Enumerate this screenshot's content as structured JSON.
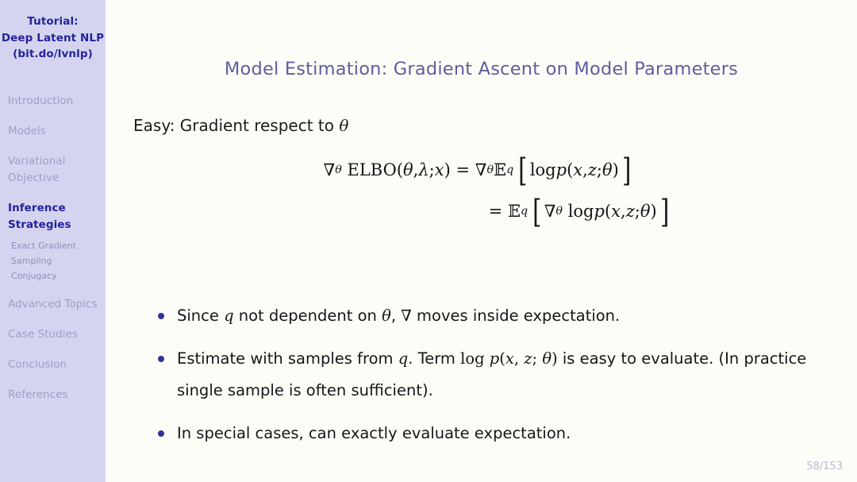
{
  "sidebar": {
    "deck_title_lines": [
      "Tutorial:",
      "Deep Latent NLP",
      "(bit.do/lvnlp)"
    ],
    "sections": [
      {
        "lines": [
          "Introduction"
        ],
        "active": false
      },
      {
        "lines": [
          "Models"
        ],
        "active": false
      },
      {
        "lines": [
          "Variational",
          "Objective"
        ],
        "active": false
      },
      {
        "lines": [
          "Inference",
          "Strategies"
        ],
        "active": true
      },
      {
        "lines": [
          "Advanced Topics"
        ],
        "active": false
      },
      {
        "lines": [
          "Case Studies"
        ],
        "active": false
      },
      {
        "lines": [
          "Conclusion"
        ],
        "active": false
      },
      {
        "lines": [
          "References"
        ],
        "active": false
      }
    ],
    "subsections": [
      "Exact Gradient",
      "Sampling",
      "Conjugacy"
    ]
  },
  "slide": {
    "frame_title": "Model Estimation: Gradient Ascent on Model Parameters",
    "intro_prefix": "Easy:  Gradient respect to ",
    "intro_symbol": "θ",
    "equations": {
      "line1": {
        "lhs_nabla": "∇",
        "lhs_nabla_sub": "θ",
        "lhs_name": "ELBO(",
        "lhs_args_theta": "θ",
        "lhs_comma": ", ",
        "lhs_args_lambda": "λ",
        "lhs_semi": "; ",
        "lhs_args_x": "x",
        "lhs_close": ")",
        "equals": "=",
        "rhs_nabla": "∇",
        "rhs_nabla_sub": "θ",
        "rhs_E": "𝔼",
        "rhs_E_sub": "q",
        "bracket_left": "[",
        "rhs_log": "log ",
        "rhs_p": "p",
        "rhs_open": "(",
        "rhs_x": "x",
        "rhs_comma": ", ",
        "rhs_z": "z",
        "rhs_semi": "; ",
        "rhs_theta": "θ",
        "rhs_close": ")",
        "bracket_right": "]"
      },
      "line2": {
        "equals": "=",
        "E": "𝔼",
        "E_sub": "q",
        "bracket_left": "[",
        "nabla": "∇",
        "nabla_sub": "θ",
        "log": "log ",
        "p": "p",
        "open": "(",
        "x": "x",
        "comma": ", ",
        "z": "z",
        "semi": "; ",
        "theta": "θ",
        "close": ")",
        "bracket_right": "]"
      }
    },
    "bullets": [
      {
        "segments": [
          {
            "type": "text",
            "value": "Since "
          },
          {
            "type": "mathit",
            "value": "q"
          },
          {
            "type": "text",
            "value": " not dependent on "
          },
          {
            "type": "mathit",
            "value": "θ"
          },
          {
            "type": "text",
            "value": ", "
          },
          {
            "type": "mathrm",
            "value": "∇"
          },
          {
            "type": "text",
            "value": " moves inside expectation."
          }
        ]
      },
      {
        "segments": [
          {
            "type": "text",
            "value": "Estimate with samples from "
          },
          {
            "type": "mathit",
            "value": "q"
          },
          {
            "type": "text",
            "value": ".  Term "
          },
          {
            "type": "mathrm",
            "value": "log "
          },
          {
            "type": "mathit",
            "value": "p"
          },
          {
            "type": "mathrm",
            "value": "("
          },
          {
            "type": "mathit",
            "value": "x"
          },
          {
            "type": "mathrm",
            "value": ", "
          },
          {
            "type": "mathit",
            "value": "z"
          },
          {
            "type": "mathrm",
            "value": "; "
          },
          {
            "type": "mathit",
            "value": "θ"
          },
          {
            "type": "mathrm",
            "value": ")"
          },
          {
            "type": "text",
            "value": " is easy to evaluate.  (In practice single sample is often sufficient)."
          }
        ]
      },
      {
        "segments": [
          {
            "type": "text",
            "value": "In special cases, can exactly evaluate expectation."
          }
        ]
      }
    ],
    "page_number": "58/153"
  },
  "colors": {
    "sidebar_bg": "#d5d4f0",
    "slide_bg": "#fdfdf8",
    "title_color": "#5e5e9e",
    "active_nav": "#24239b",
    "inactive_nav": "#9e9dc6",
    "bullet_dot": "#32329c",
    "page_number": "#b9b8d6"
  }
}
